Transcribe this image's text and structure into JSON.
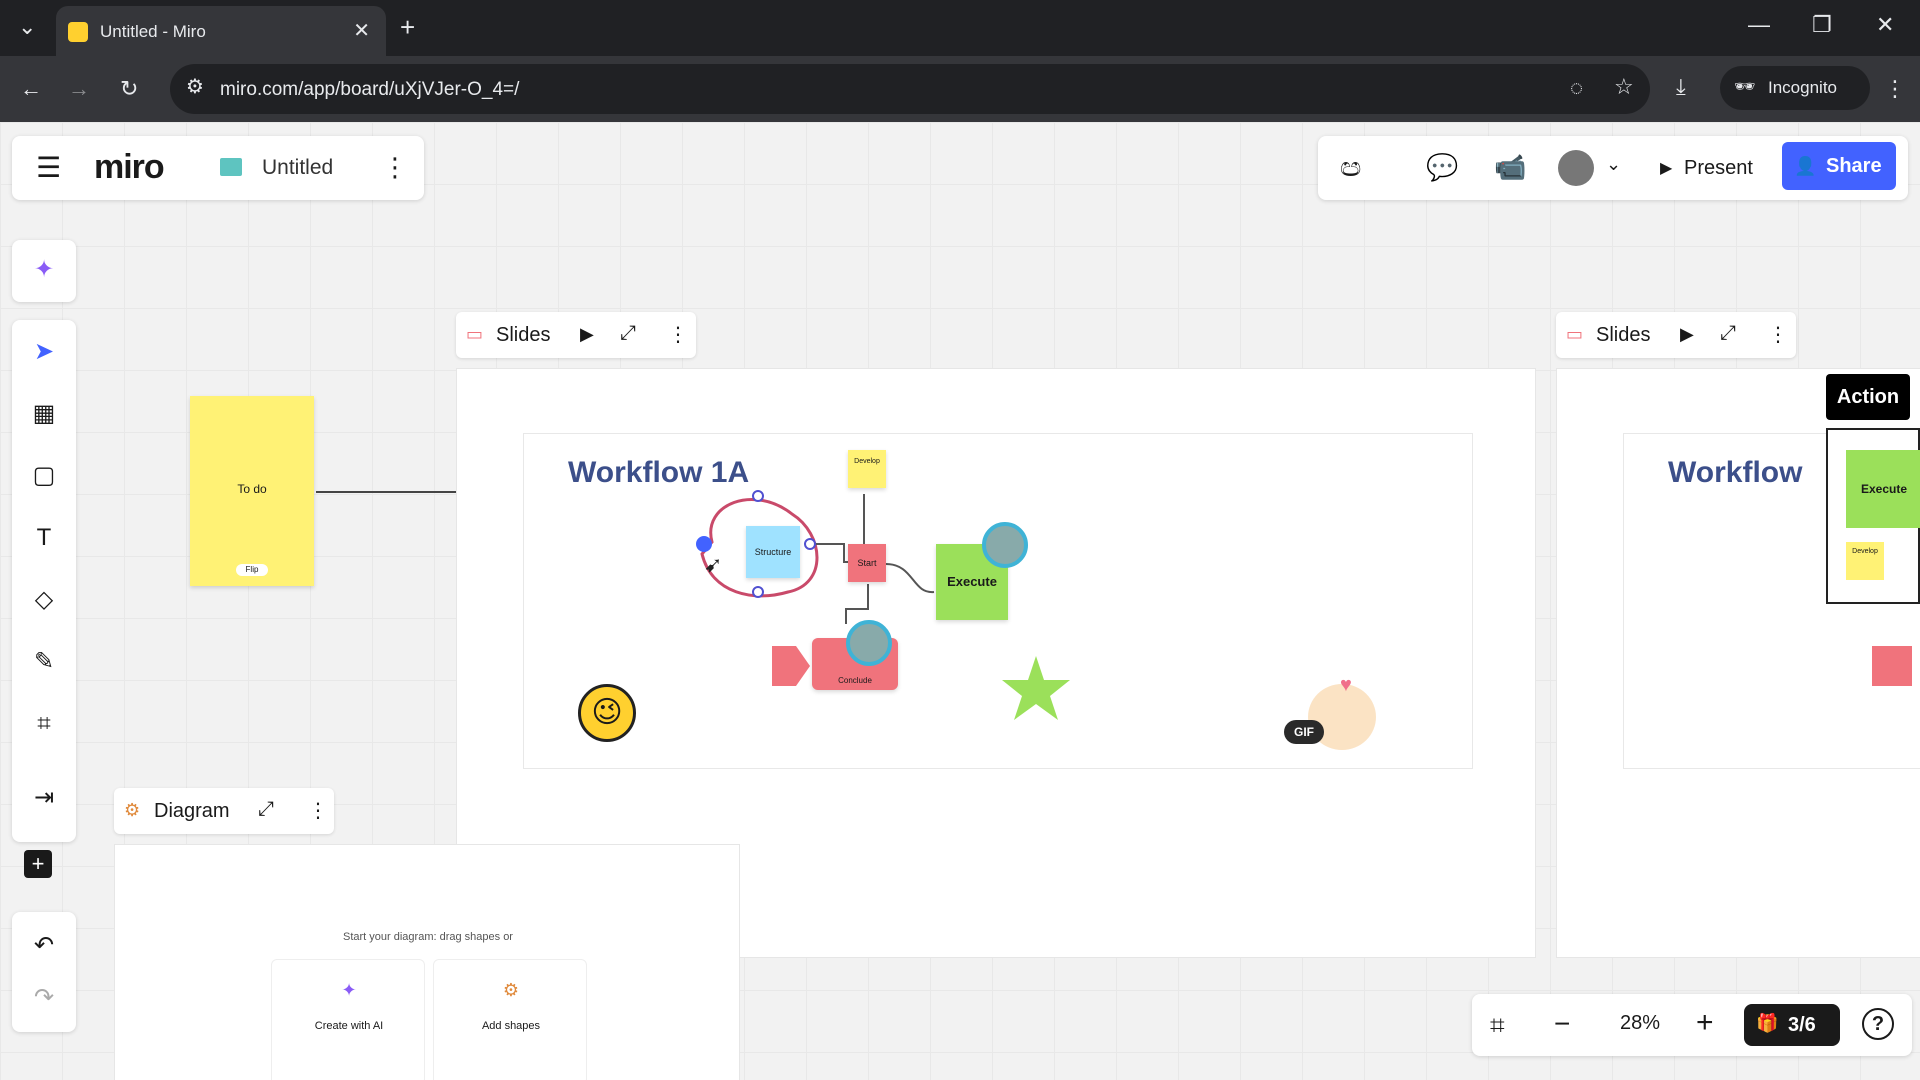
{
  "browser": {
    "tab_title": "Untitled - Miro",
    "url": "miro.com/app/board/uXjVJer-O_4=/",
    "incognito_label": "Incognito"
  },
  "miro": {
    "logo": "miro",
    "board_title": "Untitled",
    "present_label": "Present",
    "share_label": "Share",
    "colors": {
      "brand_blue": "#4262ff",
      "ai_purple": "#8a5cf6",
      "sticky_yellow": "#fff275",
      "green": "#9be05a",
      "pink": "#f0737c",
      "title_blue": "#3c4f8a"
    }
  },
  "left_toolbar": {
    "tools": [
      "ai-sparkle",
      "select",
      "templates",
      "sticky-note",
      "text",
      "shapes",
      "pen",
      "frame",
      "upload",
      "add"
    ]
  },
  "canvas": {
    "sticky_todo": "To do",
    "sticky_todo_tag": "Flip",
    "slides1_label": "Slides",
    "slides2_label": "Slides",
    "diagram_label": "Diagram",
    "workflow_title": "Workflow 1A",
    "workflow_title_2": "Workflow",
    "nodes": {
      "structure": "Structure",
      "start": "Start",
      "execute": "Execute",
      "develop": "Develop",
      "conclude": "Conclude"
    },
    "gif_badge": "GIF",
    "action_label": "Action",
    "mini_execute": "Execute",
    "mini_develop": "Develop",
    "diagram_hint": "Start your diagram: drag shapes or",
    "create_ai": "Create with AI",
    "add_shapes": "Add shapes"
  },
  "bottom": {
    "zoom": "28%",
    "pages": "3/6"
  }
}
